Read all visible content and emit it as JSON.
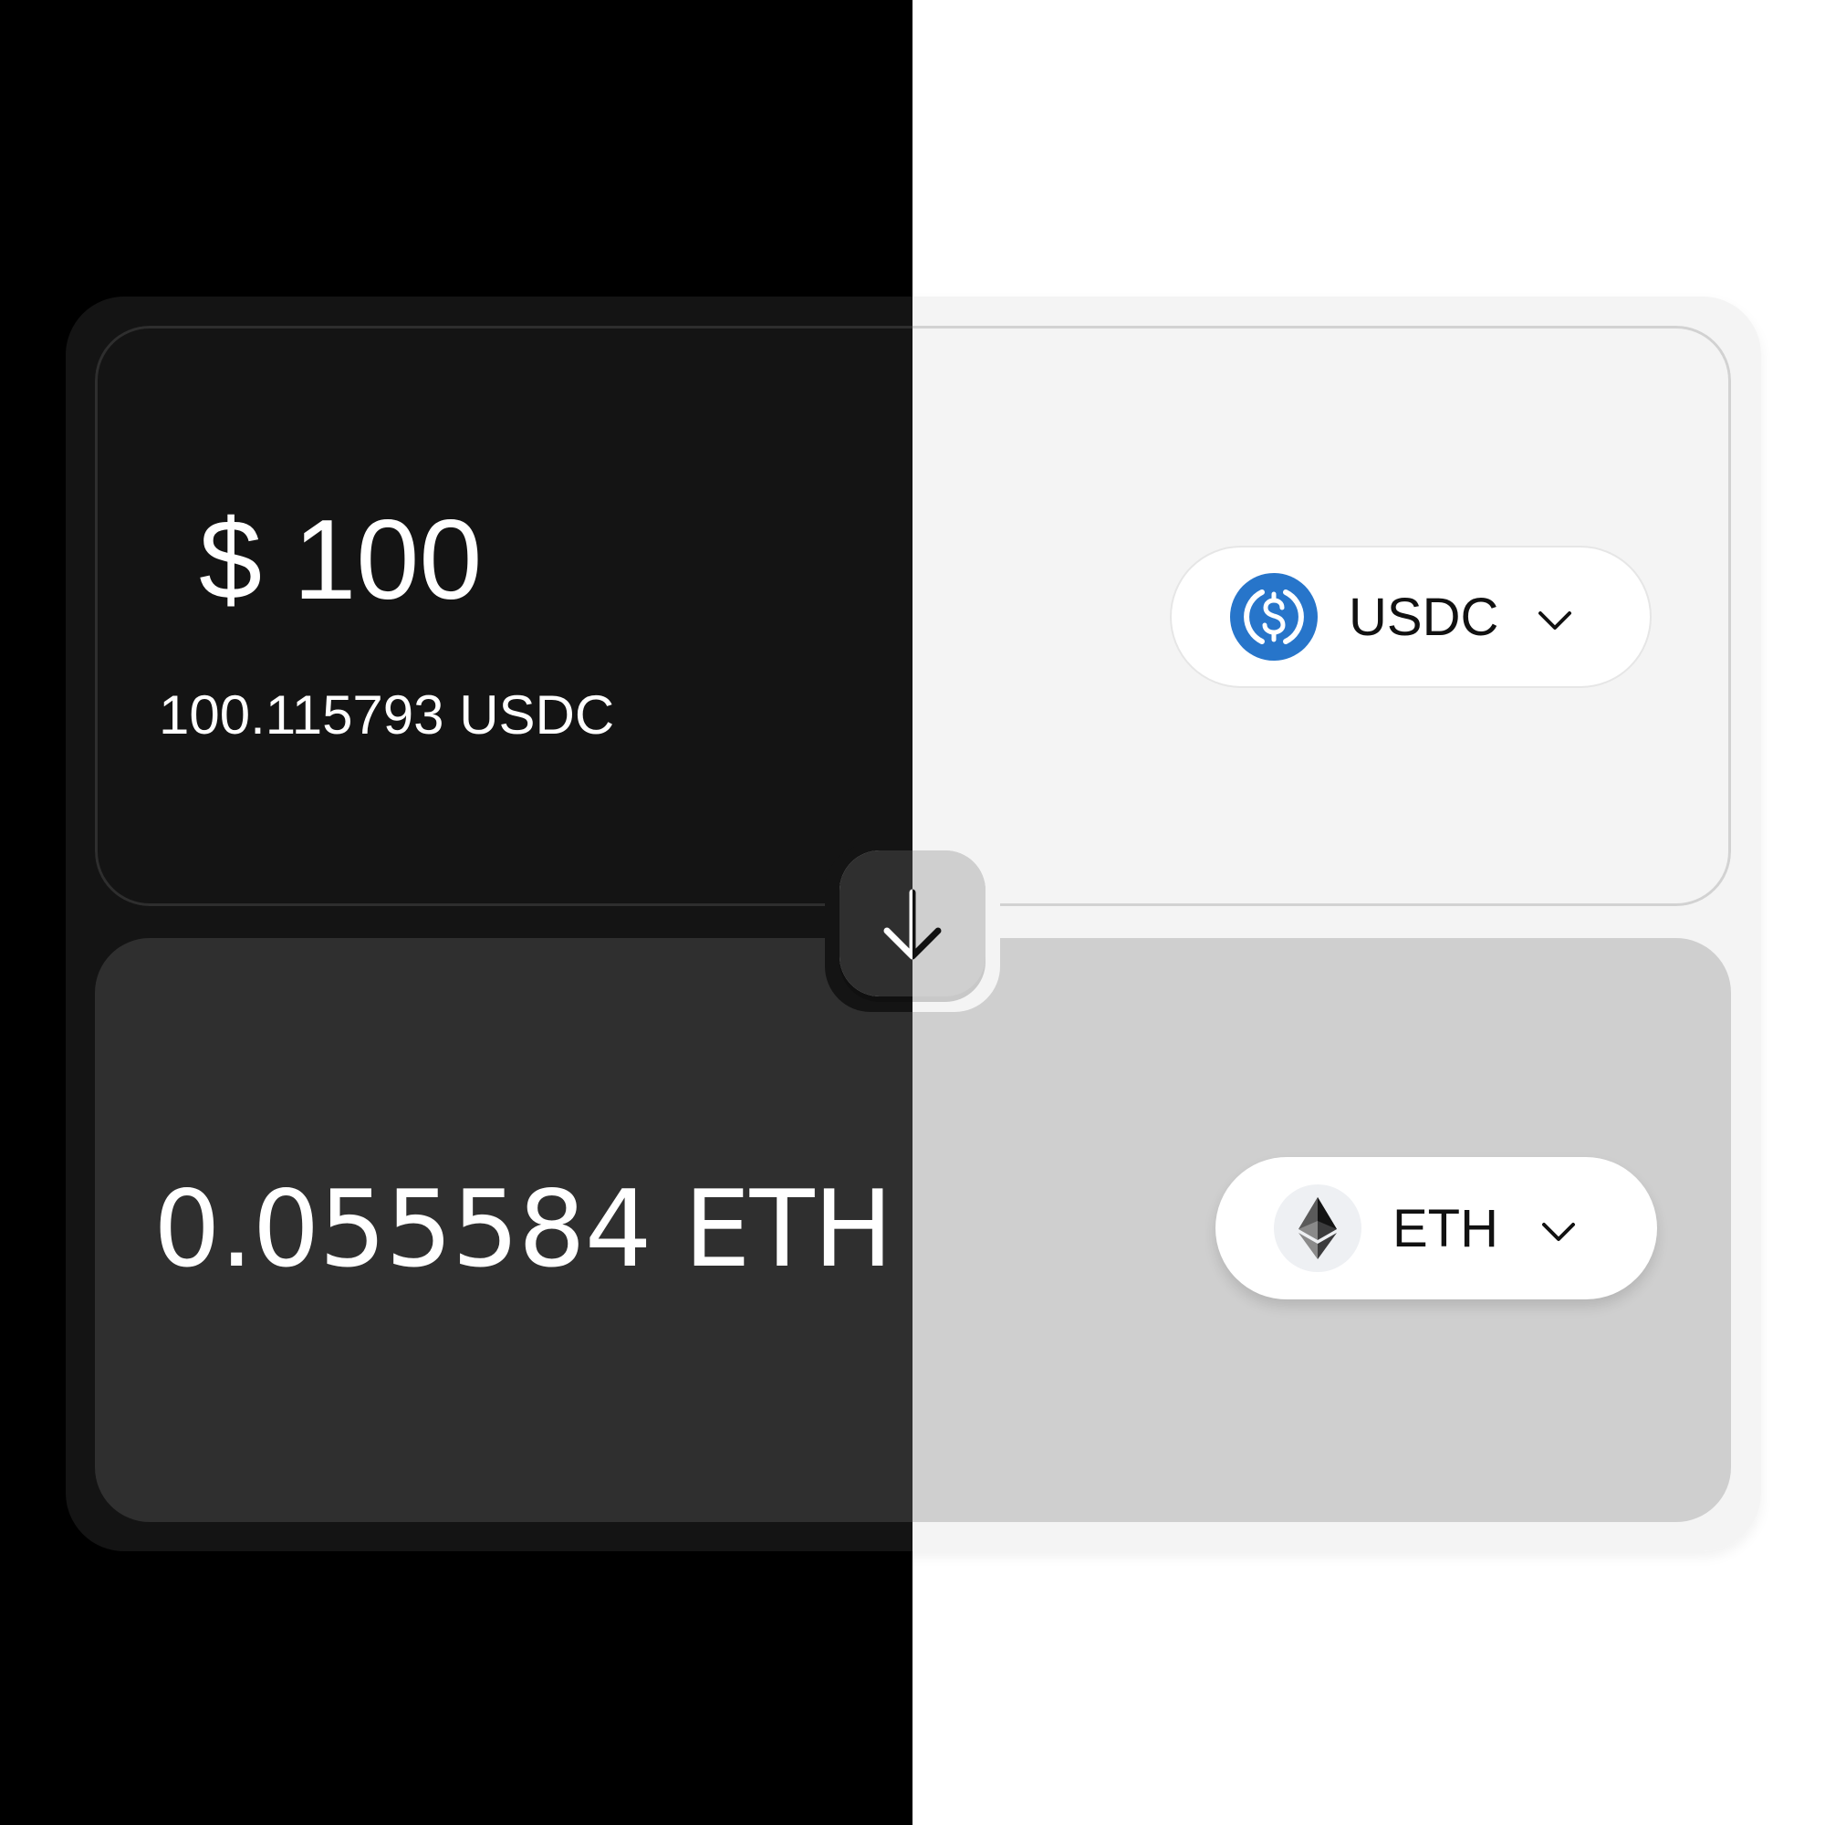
{
  "from": {
    "fiat_amount": "$ 100",
    "token_amount": "100.115793 USDC",
    "token": {
      "symbol": "USDC",
      "icon": "usdc-icon",
      "icon_color": "#2775ca"
    }
  },
  "to": {
    "token_amount": "0.055584 ETH",
    "token": {
      "symbol": "ETH",
      "icon": "eth-icon"
    }
  },
  "swap_button": {
    "icon": "arrow-down-icon"
  },
  "theme": {
    "dark_background": "#000000",
    "light_background": "#ffffff"
  }
}
